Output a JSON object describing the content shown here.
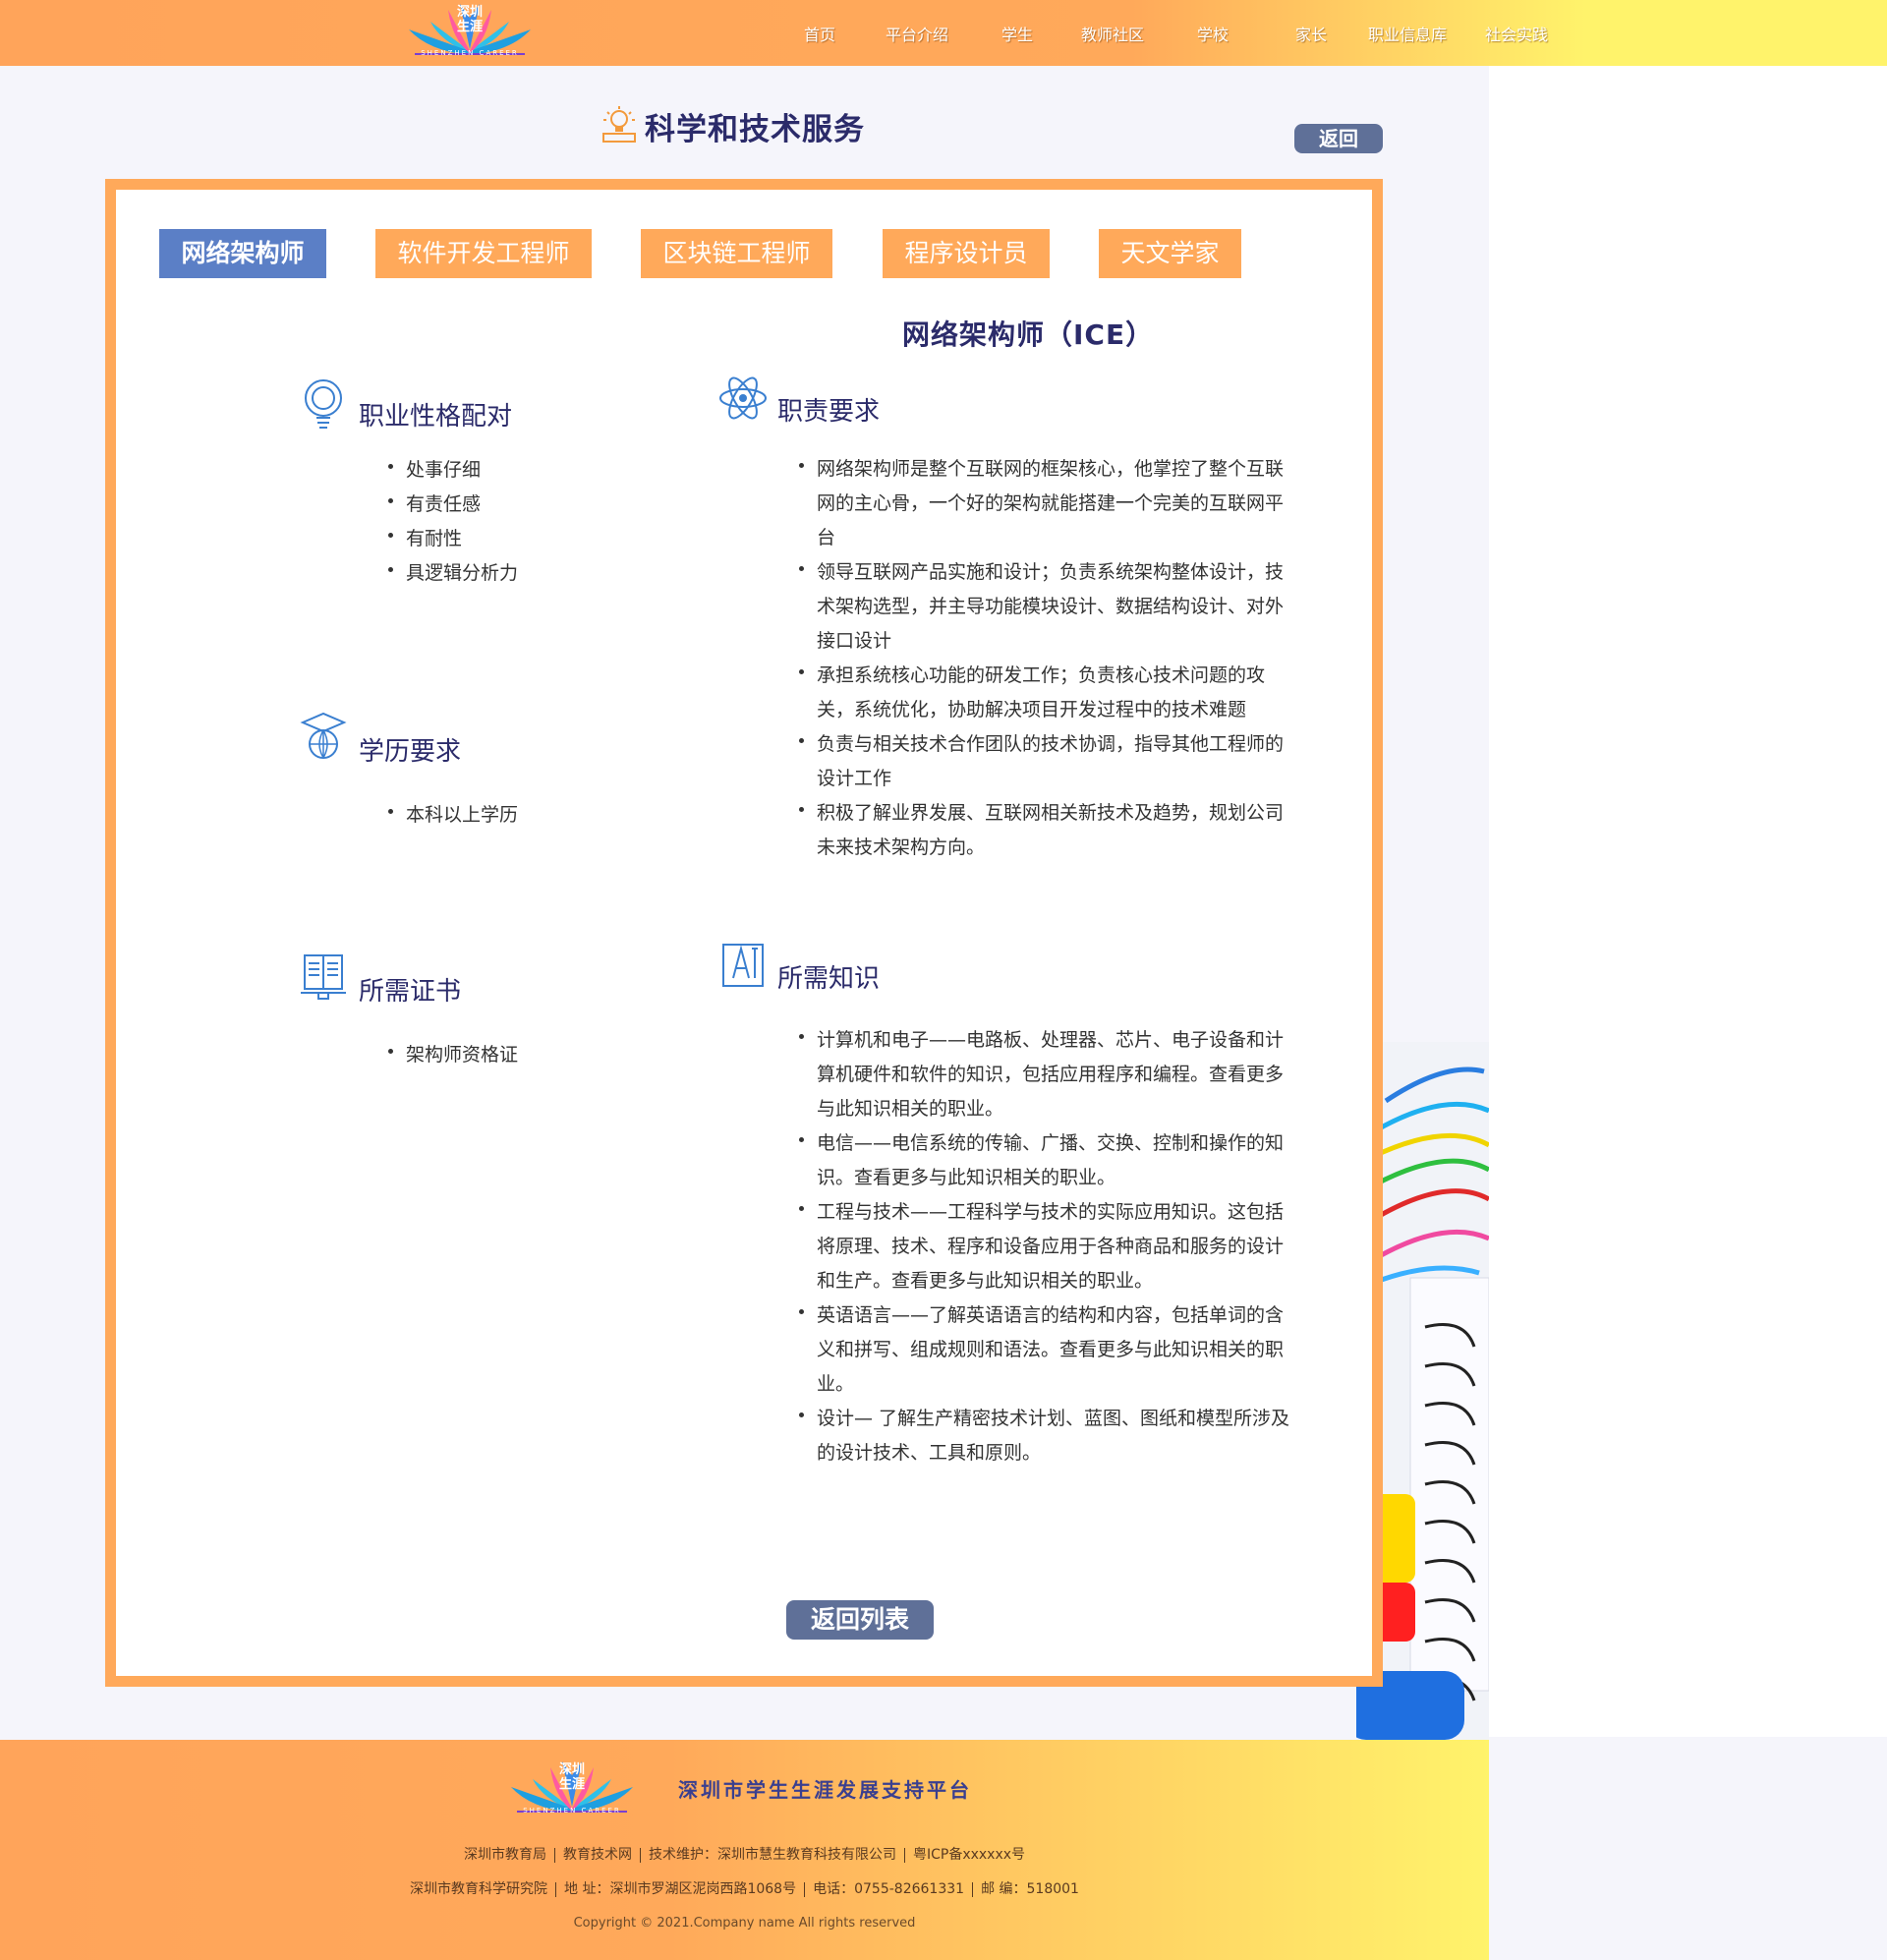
{
  "header": {
    "logo": {
      "cn": "深圳生涯",
      "en": "SHENZHEN CAREER"
    },
    "nav": [
      "首页",
      "平台介绍",
      "学生",
      "教师社区",
      "学校",
      "家长",
      "职业信息库",
      "社会实践"
    ]
  },
  "page": {
    "title": "科学和技术服务",
    "back_label": "返回"
  },
  "tabs": [
    "网络架构师",
    "软件开发工程师",
    "区块链工程师",
    "程序设计员",
    "天文学家"
  ],
  "active_tab": "网络架构师",
  "career": {
    "title": "网络架构师（ICE）",
    "personality": {
      "title": "职业性格配对",
      "items": [
        "处事仔细",
        "有责任感",
        "有耐性",
        "具逻辑分析力"
      ]
    },
    "education": {
      "title": "学历要求",
      "items": [
        "本科以上学历"
      ]
    },
    "certificates": {
      "title": "所需证书",
      "items": [
        "架构师资格证"
      ]
    },
    "duties": {
      "title": "职责要求",
      "items": [
        "网络架构师是整个互联网的框架核心，他掌控了整个互联网的主心骨，一个好的架构就能搭建一个完美的互联网平台",
        "领导互联网产品实施和设计；负责系统架构整体设计，技术架构选型，并主导功能模块设计、数据结构设计、对外接口设计",
        "承担系统核心功能的研发工作；负责核心技术问题的攻关，系统优化，协助解决项目开发过程中的技术难题",
        "负责与相关技术合作团队的技术协调，指导其他工程师的设计工作",
        "积极了解业界发展、互联网相关新技术及趋势，规划公司未来技术架构方向。"
      ]
    },
    "knowledge": {
      "title": "所需知识",
      "items": [
        "计算机和电子——电路板、处理器、芯片、电子设备和计算机硬件和软件的知识，包括应用程序和编程。查看更多与此知识相关的职业。",
        "电信——电信系统的传输、广播、交换、控制和操作的知识。查看更多与此知识相关的职业。",
        "工程与技术——工程科学与技术的实际应用知识。这包括将原理、技术、程序和设备应用于各种商品和服务的设计和生产。查看更多与此知识相关的职业。",
        "英语语言——了解英语语言的结构和内容，包括单词的含义和拼写、组成规则和语法。查看更多与此知识相关的职业。",
        "设计— 了解生产精密技术计划、蓝图、图纸和模型所涉及的设计技术、工具和原则。"
      ]
    }
  },
  "list_back_label": "返回列表",
  "footer": {
    "logo": {
      "cn": "深圳生涯",
      "en": "SHENZHEN CAREER"
    },
    "platform_name": "深圳市学生生涯发展支持平台",
    "line1": [
      "深圳市教育局",
      "教育技术网",
      "技术维护：深圳市慧生教育科技有限公司",
      "粤ICP备xxxxxx号"
    ],
    "line2": [
      "深圳市教育科学研究院",
      "地  址：深圳市罗湖区泥岗西路1068号",
      "电话：0755-82661331",
      "邮  编：518001"
    ],
    "copyright": "Copyright © 2021.Company name All rights reserved"
  },
  "colors": {
    "brand_orange": "#ffa95a",
    "brand_yellow": "#fff36b",
    "active_tab_blue": "#5b7fc6",
    "title_navy": "#2b2b6a",
    "button_slate": "#5f7098"
  }
}
